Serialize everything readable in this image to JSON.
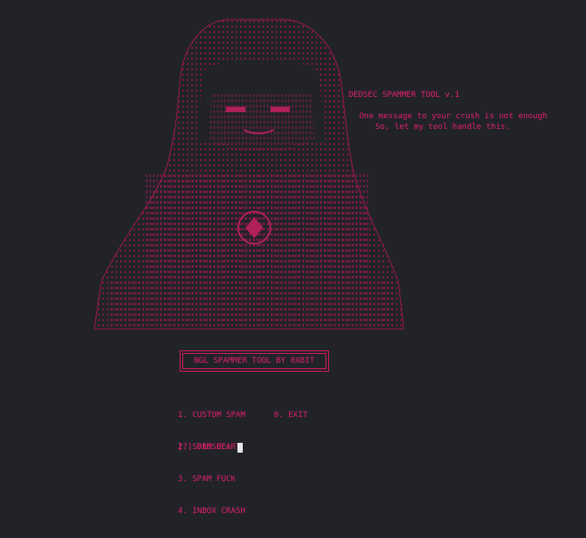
{
  "banner": {
    "title": "DEDSEC SPAMMER TOOL v.1",
    "tagline_line1": "One message to your crush is not enough",
    "tagline_line2": "So, let my tool handle this."
  },
  "tool_title": "NGL SPAMMER TOOL BY 0XBIT",
  "menu": {
    "items": [
      {
        "label": "1. CUSTOM SPAM"
      },
      {
        "label": "0. EXIT"
      },
      {
        "label": "2. SPAM HEART"
      },
      {
        "label": "3. SPAM FUCK"
      },
      {
        "label": "4. INBOX CRASH"
      }
    ]
  },
  "prompt": {
    "label": "[?] DEDSEC: "
  },
  "colors": {
    "background": "#222329",
    "accent": "#e0206b",
    "cursor": "#e8e8e8"
  },
  "icons": {
    "art": "hooded-figure-ascii-art-icon"
  }
}
